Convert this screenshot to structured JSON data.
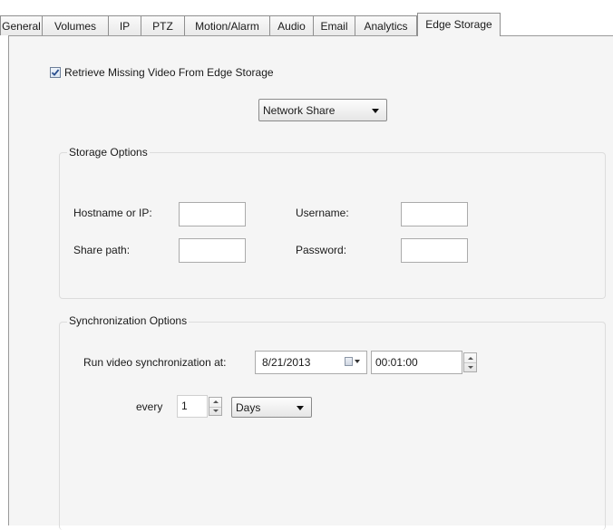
{
  "tabs": [
    {
      "label": "General"
    },
    {
      "label": "Volumes"
    },
    {
      "label": "IP"
    },
    {
      "label": "PTZ"
    },
    {
      "label": "Motion/Alarm"
    },
    {
      "label": "Audio"
    },
    {
      "label": "Email"
    },
    {
      "label": "Analytics"
    },
    {
      "label": "Edge Storage",
      "active": true
    }
  ],
  "retrieve_checkbox": {
    "label": "Retrieve Missing Video From Edge Storage",
    "checked": true
  },
  "storage_type": {
    "selected": "Network Share"
  },
  "storage_options": {
    "title": "Storage Options",
    "hostname_label": "Hostname or IP:",
    "hostname_value": "",
    "username_label": "Username:",
    "username_value": "",
    "share_path_label": "Share path:",
    "share_path_value": "",
    "password_label": "Password:",
    "password_value": ""
  },
  "sync_options": {
    "title": "Synchronization Options",
    "run_label": "Run video synchronization at:",
    "date_value": "8/21/2013",
    "time_value": "00:01:00",
    "every_label": "every",
    "interval_value": "1",
    "unit_selected": "Days"
  },
  "colors": {
    "panel_bg": "#f5f5f5",
    "border": "#8f8f8f",
    "checkbox_accent": "#2a4f8f"
  }
}
